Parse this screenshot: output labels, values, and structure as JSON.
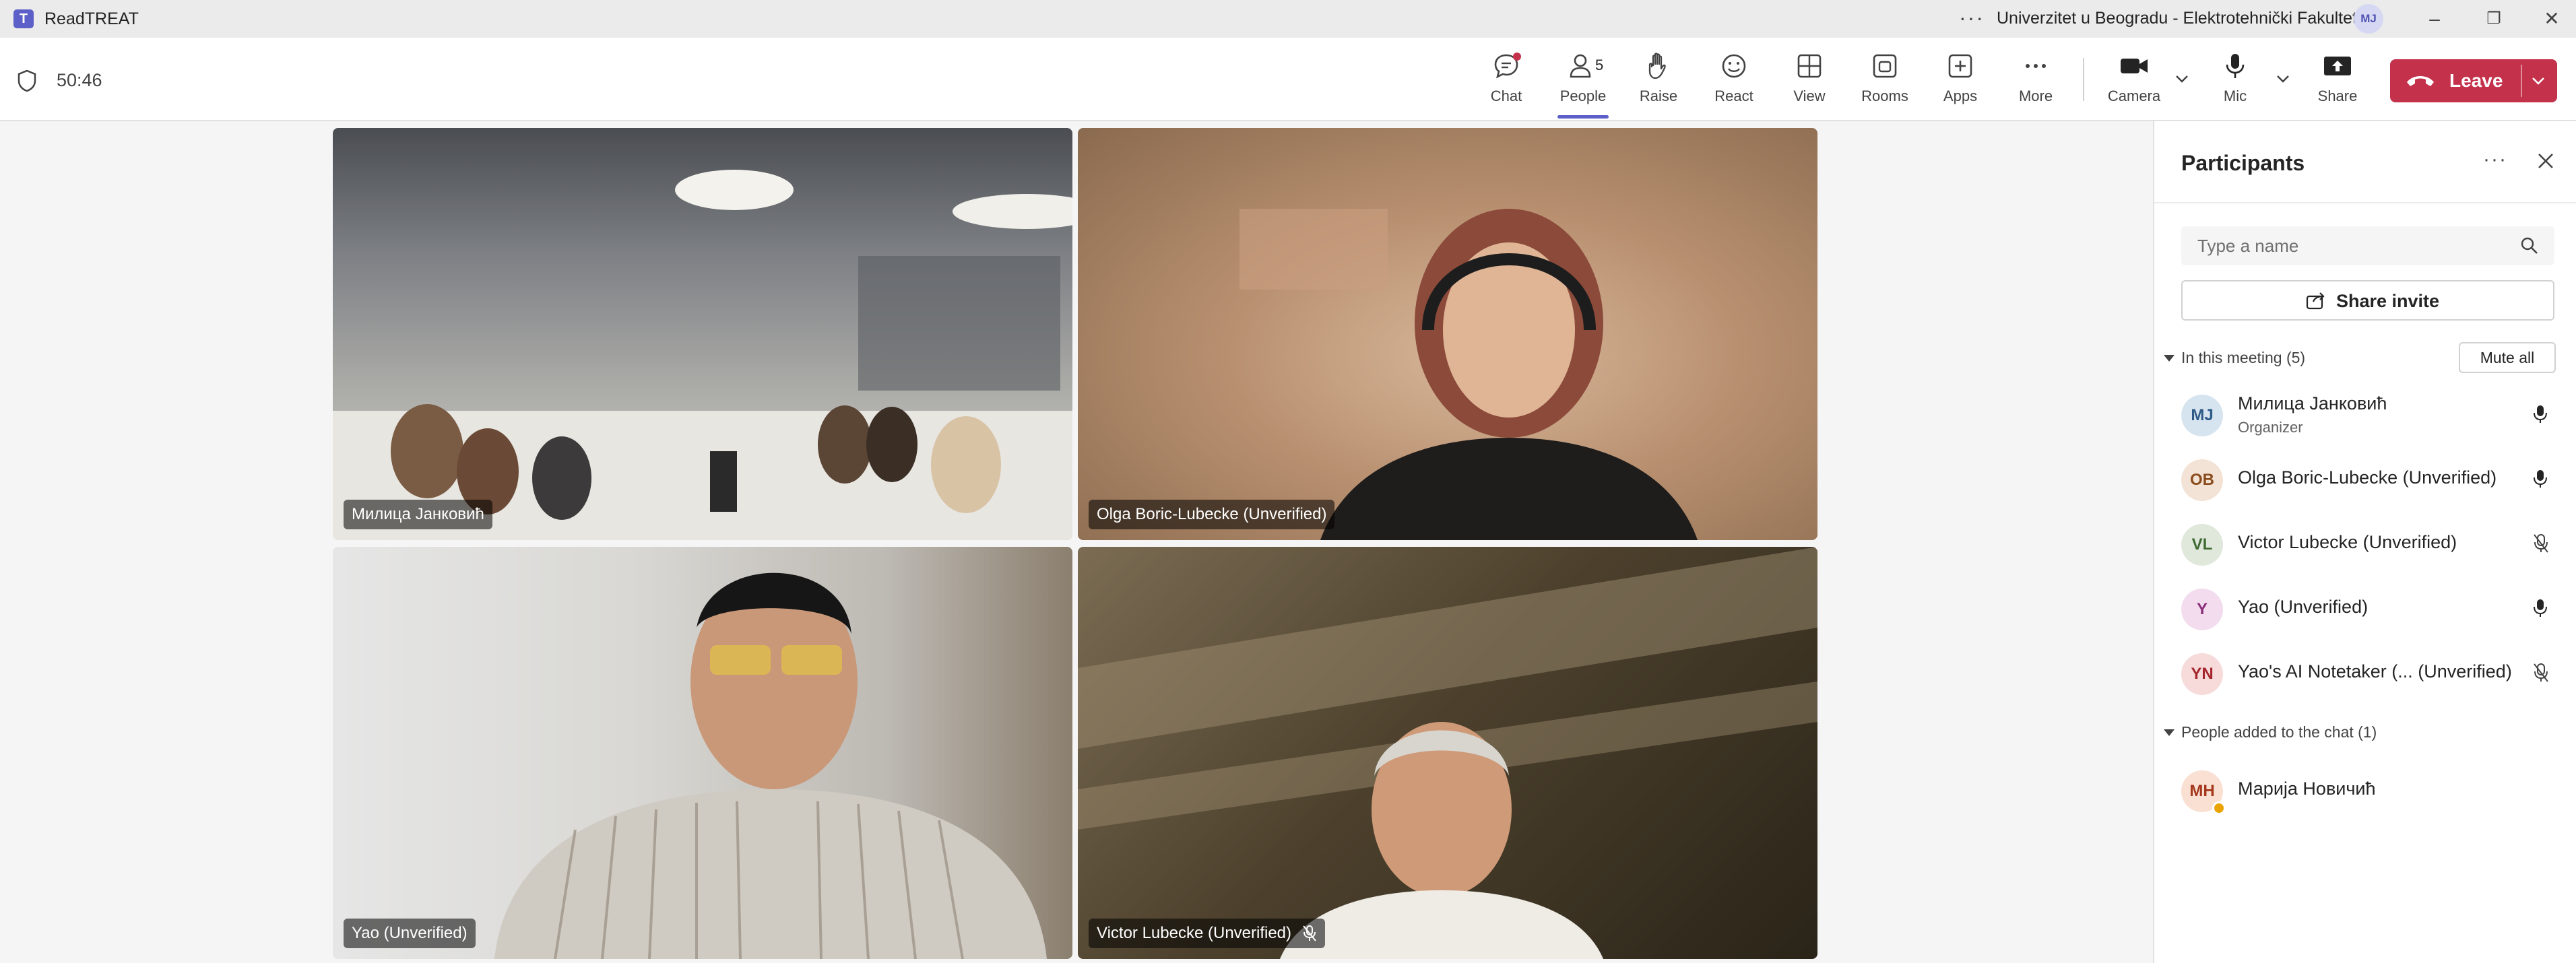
{
  "titlebar": {
    "app_logo": "T",
    "app_title": "ReadTREAT",
    "more": "···",
    "org": "Univerzitet u Beogradu - Elektrotehnički Fakultet",
    "avatar": "MJ",
    "minimize": "–",
    "restore": "❐",
    "close": "✕"
  },
  "toolbar": {
    "timer": "50:46",
    "chat": "Chat",
    "people": "People",
    "people_count": "5",
    "raise": "Raise",
    "react": "React",
    "view": "View",
    "rooms": "Rooms",
    "apps": "Apps",
    "more": "More",
    "camera": "Camera",
    "mic": "Mic",
    "share": "Share",
    "leave": "Leave"
  },
  "tiles": [
    {
      "name": "Милица Јанковић"
    },
    {
      "name": "Olga Boric-Lubecke (Unverified)"
    },
    {
      "name": "Yao (Unverified)"
    },
    {
      "name": "Victor Lubecke (Unverified)"
    }
  ],
  "panel": {
    "title": "Participants",
    "more": "···",
    "search_placeholder": "Type a name",
    "share_invite": "Share invite",
    "in_meeting": "In this meeting (5)",
    "mute_all": "Mute all",
    "participants": [
      {
        "initials": "MJ",
        "name": "Милица Јанковић",
        "role": "Organizer",
        "muted": false
      },
      {
        "initials": "OB",
        "name": "Olga Boric-Lubecke (Unverified)",
        "muted": false
      },
      {
        "initials": "VL",
        "name": "Victor Lubecke (Unverified)",
        "muted": true
      },
      {
        "initials": "Y",
        "name": "Yao (Unverified)",
        "muted": false
      },
      {
        "initials": "YN",
        "name": "Yao's AI Notetaker (...  (Unverified)",
        "muted": true
      }
    ],
    "added_heading": "People added to the chat (1)",
    "added": [
      {
        "initials": "MH",
        "name": "Марија Новичић"
      }
    ]
  },
  "colors": {
    "accent": "#5b5fc7",
    "leave": "#c4314b",
    "away": "#eaa300"
  }
}
